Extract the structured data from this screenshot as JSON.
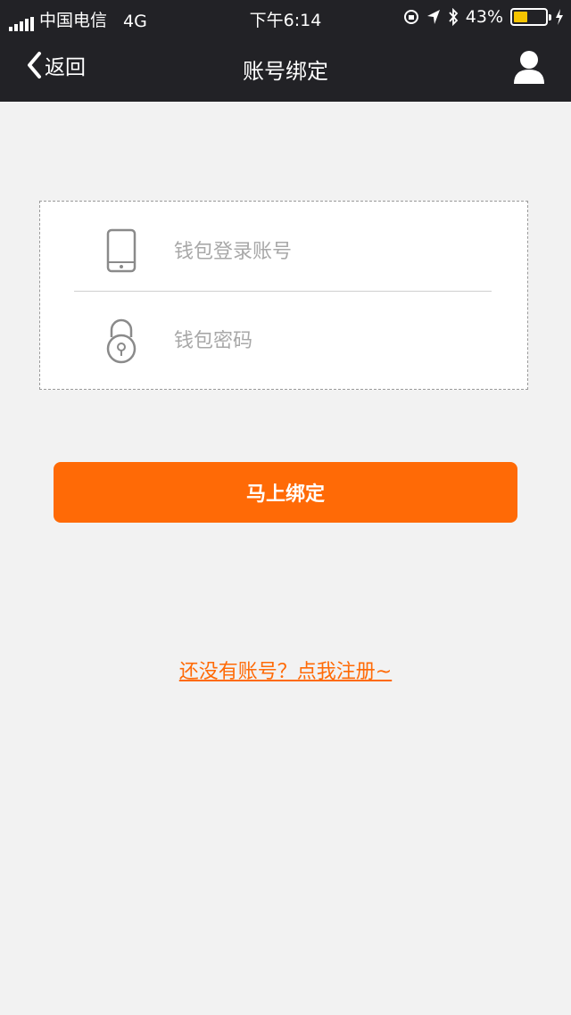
{
  "status_bar": {
    "carrier": "中国电信",
    "network": "4G",
    "time": "下午6:14",
    "battery_percent": "43%",
    "battery_level": 0.43,
    "battery_color": "#f5c400"
  },
  "nav": {
    "back_label": "返回",
    "title": "账号绑定",
    "back_icon": "chevron-left-icon",
    "user_icon": "user-icon"
  },
  "form": {
    "account": {
      "placeholder": "钱包登录账号",
      "value": "",
      "icon": "phone-icon"
    },
    "password": {
      "placeholder": "钱包密码",
      "value": "",
      "icon": "lock-icon"
    }
  },
  "actions": {
    "bind_label": "马上绑定",
    "register_link": "还没有账号？点我注册~"
  },
  "colors": {
    "accent": "#ff6a06",
    "header_bg": "#222226",
    "page_bg": "#f2f2f2"
  }
}
